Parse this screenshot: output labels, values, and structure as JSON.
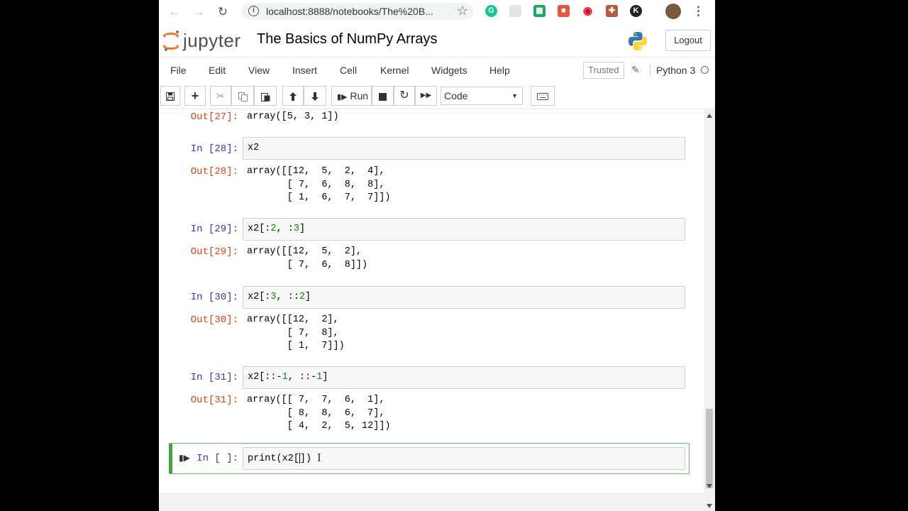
{
  "browser": {
    "url": "localhost:8888/notebooks/The%20B...",
    "extensions": [
      "grammarly-icon",
      "picture-icon",
      "sheets-icon",
      "addon-icon",
      "pinterest-icon",
      "pdf-icon",
      "k-icon"
    ],
    "k_label": "K"
  },
  "header": {
    "logo_text": "jupyter",
    "notebook_title": "The Basics of NumPy Arrays",
    "logout_label": "Logout"
  },
  "menubar": {
    "items": [
      "File",
      "Edit",
      "View",
      "Insert",
      "Cell",
      "Kernel",
      "Widgets",
      "Help"
    ],
    "trusted": "Trusted",
    "kernel_name": "Python 3"
  },
  "toolbar": {
    "run_label": "Run",
    "cell_type": "Code"
  },
  "cells": [
    {
      "out_prompt": "Out[27]:",
      "output": "array([5, 3, 1])"
    },
    {
      "in_prompt": "In [28]:",
      "code": "x2",
      "out_prompt": "Out[28]:",
      "output": "array([[12,  5,  2,  4],\n       [ 7,  6,  8,  8],\n       [ 1,  6,  7,  7]])"
    },
    {
      "in_prompt": "In [29]:",
      "code_pre": "x2[:",
      "code_n1": "2",
      "code_mid": ", :",
      "code_n2": "3",
      "code_post": "]",
      "out_prompt": "Out[29]:",
      "output": "array([[12,  5,  2],\n       [ 7,  6,  8]])"
    },
    {
      "in_prompt": "In [30]:",
      "code_pre": "x2[:",
      "code_n1": "3",
      "code_mid": ", ::",
      "code_n2": "2",
      "code_post": "]",
      "out_prompt": "Out[30]:",
      "output": "array([[12,  2],\n       [ 7,  8],\n       [ 1,  7]])"
    },
    {
      "in_prompt": "In [31]:",
      "code_pre": "x2[::-",
      "code_n1": "1",
      "code_mid": ", ::-",
      "code_n2": "1",
      "code_post": "]",
      "out_prompt": "Out[31]:",
      "output": "array([[ 7,  7,  6,  1],\n       [ 8,  8,  6,  7],\n       [ 4,  2,  5, 12]])"
    },
    {
      "in_prompt": "In [ ]:",
      "code_pre": "print(x2[",
      "code_post": "])"
    }
  ],
  "colors": {
    "jupyter_orange": "#f37726",
    "in_prompt": "#303f9f",
    "out_prompt": "#d84315",
    "selected_border": "#42a545",
    "number": "#008800"
  }
}
